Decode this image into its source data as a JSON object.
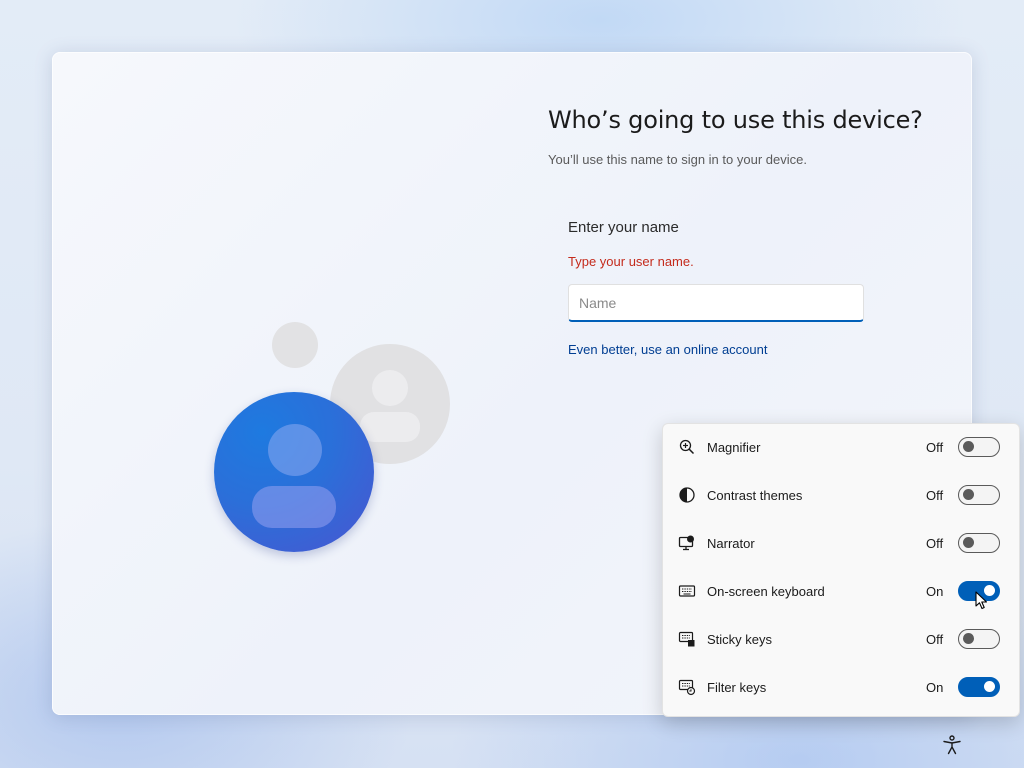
{
  "setup": {
    "title": "Who’s going to use this device?",
    "subtitle": "You’ll use this name to sign in to your device.",
    "field_label": "Enter your name",
    "error_text": "Type your user name.",
    "name_placeholder": "Name",
    "name_value": "",
    "online_account_link": "Even better, use an online account"
  },
  "accessibility_flyout": {
    "items": [
      {
        "label": "Magnifier",
        "state": "Off",
        "on": false,
        "icon": "magnifier-icon"
      },
      {
        "label": "Contrast themes",
        "state": "Off",
        "on": false,
        "icon": "contrast-icon"
      },
      {
        "label": "Narrator",
        "state": "Off",
        "on": false,
        "icon": "narrator-icon"
      },
      {
        "label": "On-screen keyboard",
        "state": "On",
        "on": true,
        "icon": "keyboard-icon"
      },
      {
        "label": "Sticky keys",
        "state": "Off",
        "on": false,
        "icon": "sticky-keys-icon"
      },
      {
        "label": "Filter keys",
        "state": "On",
        "on": true,
        "icon": "filter-keys-icon"
      }
    ]
  },
  "colors": {
    "accent": "#005fb8",
    "error": "#c42b1c",
    "link": "#003e92"
  }
}
